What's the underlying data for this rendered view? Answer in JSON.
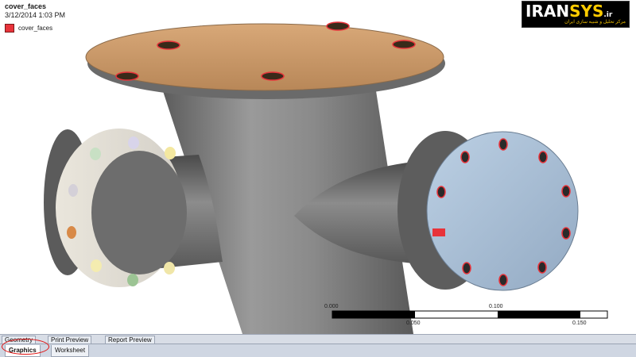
{
  "info": {
    "title": "cover_faces",
    "date": "3/12/2014 1:03 PM"
  },
  "legend": {
    "label": "cover_faces",
    "color": "#e8333a"
  },
  "logo": {
    "main_a": "IRAN",
    "main_b": "SYS",
    "tld": ".ir",
    "subtitle": "مرکز تحلیل و شبیه سازی ایران"
  },
  "scale": {
    "top_labels": [
      "0.000",
      "0.100"
    ],
    "bottom_labels": [
      "0.050",
      "0.150"
    ]
  },
  "tabs_top": [
    "Geometry",
    "Print Preview",
    "Report Preview"
  ],
  "tabs_bottom": {
    "active": "Graphics",
    "other": "Worksheet"
  },
  "colors": {
    "pipe": "#7d7d7d",
    "cover_top": "#c9986a",
    "cover_right": "#a9bfd6",
    "highlight_red": "#e8333a"
  }
}
